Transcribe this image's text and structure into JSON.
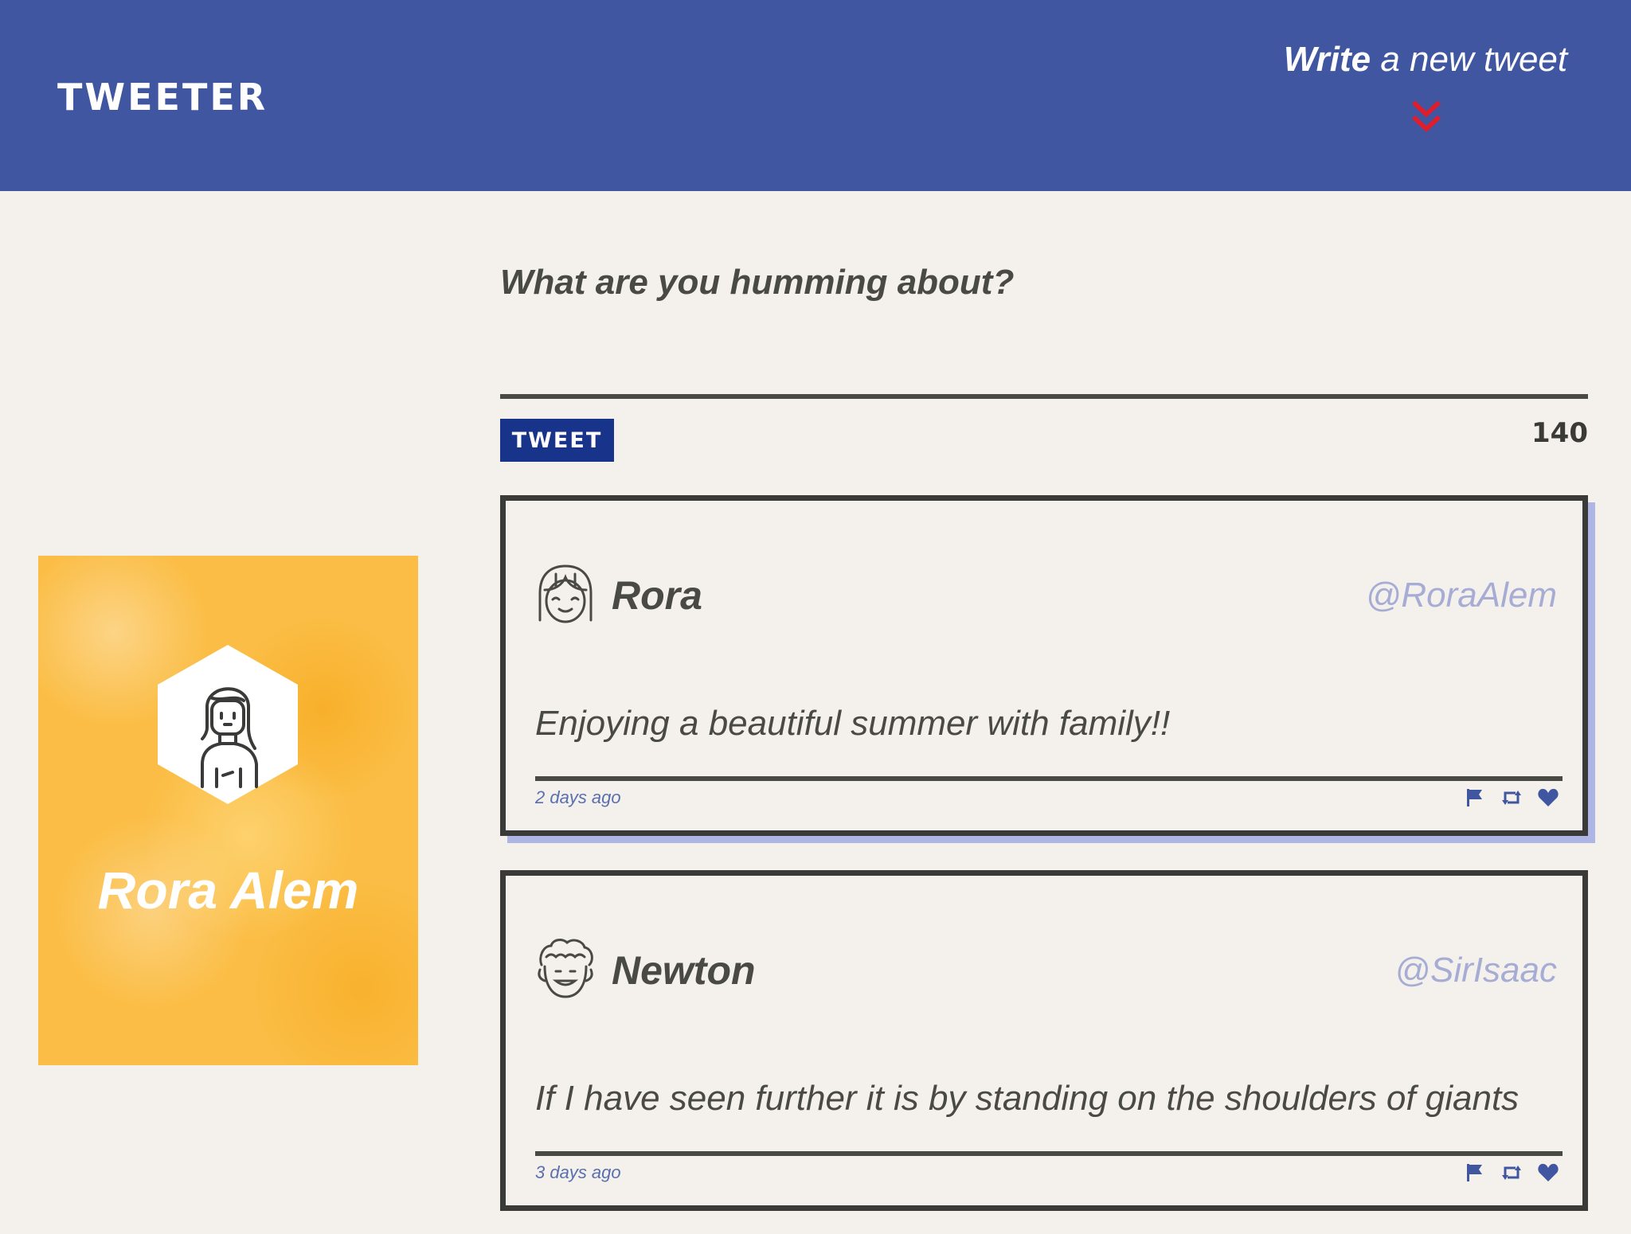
{
  "nav": {
    "brand": "TWEETER",
    "compose_toggle_bold": "Write",
    "compose_toggle_rest": " a new tweet"
  },
  "profile": {
    "name": "Rora Alem"
  },
  "compose": {
    "prompt": "What are you humming about?",
    "button_label": "TWEET",
    "counter": "140"
  },
  "tweets": [
    {
      "name": "Rora",
      "handle": "@RoraAlem",
      "text": "Enjoying a beautiful summer with family!!",
      "time": "2 days ago",
      "avatar_icon": "girl-face-icon"
    },
    {
      "name": "Newton",
      "handle": "@SirIsaac",
      "text": "If I have seen further it is by standing on the shoulders of giants",
      "time": "3 days ago",
      "avatar_icon": "curly-hair-man-icon"
    }
  ],
  "colors": {
    "nav_bg": "#4056a1",
    "page_bg": "#f4f1ed",
    "button_bg": "#17338a",
    "chevron": "#e01d2a",
    "handle": "#a6acd3",
    "action_icons": "#4056a1",
    "profile_bg": "#fbbd45"
  }
}
